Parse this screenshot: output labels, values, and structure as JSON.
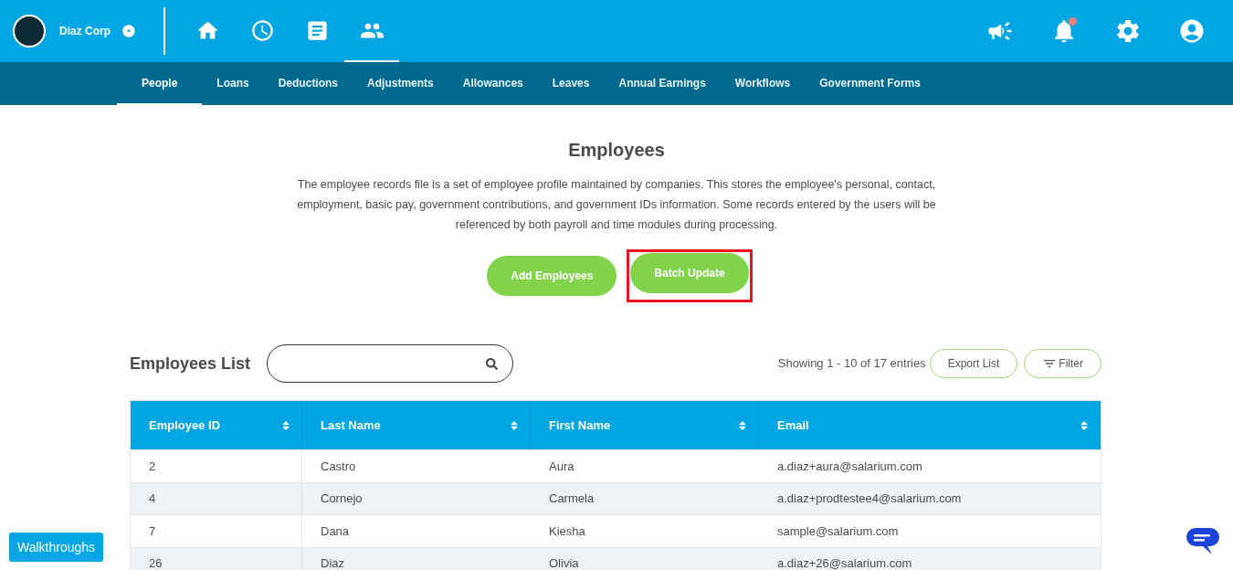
{
  "header": {
    "company": "Diaz Corp",
    "nav_icons": [
      {
        "kind": "home",
        "selected": false
      },
      {
        "kind": "clock",
        "selected": false
      },
      {
        "kind": "document",
        "selected": false
      },
      {
        "kind": "people",
        "selected": true
      }
    ],
    "right_icons": [
      {
        "kind": "megaphone",
        "unread": false
      },
      {
        "kind": "bell",
        "unread": true
      },
      {
        "kind": "gear",
        "unread": false
      },
      {
        "kind": "account",
        "unread": false
      }
    ]
  },
  "tabs": [
    {
      "label": "People",
      "selected": true
    },
    {
      "label": "Loans",
      "selected": false
    },
    {
      "label": "Deductions",
      "selected": false
    },
    {
      "label": "Adjustments",
      "selected": false
    },
    {
      "label": "Allowances",
      "selected": false
    },
    {
      "label": "Leaves",
      "selected": false
    },
    {
      "label": "Annual Earnings",
      "selected": false
    },
    {
      "label": "Workflows",
      "selected": false
    },
    {
      "label": "Government Forms",
      "selected": false
    }
  ],
  "title": "Employees",
  "description": "The employee records file is a set of employee profile maintained by companies. This stores the employee's personal, contact, employment, basic pay, government contributions, and government IDs information. Some records entered by the users will be referenced by both payroll and time modules during processing.",
  "actions": [
    {
      "label": "Add Employees",
      "highlighted": false
    },
    {
      "label": "Batch Update",
      "highlighted": true
    }
  ],
  "list": {
    "title": "Employees List",
    "showing": "Showing 1 - 10 of 17 entries",
    "export": "Export List",
    "filter": "Filter"
  },
  "table": {
    "columns": [
      "Employee ID",
      "Last Name",
      "First Name",
      "Email"
    ],
    "rows": [
      [
        "2",
        "Castro",
        "Aura",
        "a.diaz+aura@salarium.com"
      ],
      [
        "4",
        "Cornejo",
        "Carmela",
        "a.diaz+prodtestee4@salarium.com"
      ],
      [
        "7",
        "Dana",
        "Kiesha",
        "sample@salarium.com"
      ],
      [
        "26",
        "Diaz",
        "Olivia",
        "a.diaz+26@salarium.com"
      ]
    ]
  },
  "walkthroughs": "Walkthroughs"
}
